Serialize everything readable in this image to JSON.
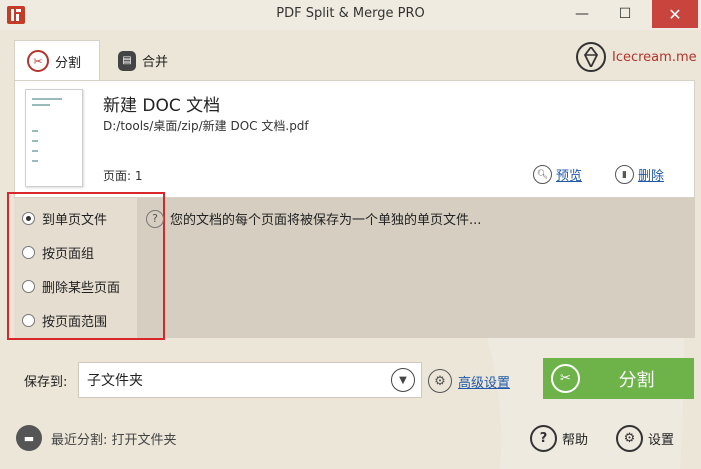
{
  "window": {
    "title": "PDF Split & Merge PRO",
    "min_glyph": "—",
    "max_glyph": "☐",
    "close_glyph": "✕"
  },
  "tabs": [
    {
      "label": "分割",
      "icon": "scissors-icon",
      "active": true
    },
    {
      "label": "合并",
      "icon": "merge-icon",
      "active": false
    }
  ],
  "brand": {
    "text": "Icecream.me",
    "icon": "icecream-logo-icon"
  },
  "file": {
    "name": "新建 DOC 文档",
    "path": "D:/tools/桌面/zip/新建 DOC 文档.pdf",
    "pages_label": "页面:",
    "pages_value": "1",
    "preview_label": "预览",
    "delete_label": "删除"
  },
  "options": {
    "items": [
      {
        "label": "到单页文件",
        "selected": true
      },
      {
        "label": "按页面组",
        "selected": false
      },
      {
        "label": "删除某些页面",
        "selected": false
      },
      {
        "label": "按页面范围",
        "selected": false
      }
    ],
    "help_text": "您的文档的每个页面将被保存为一个单独的单页文件..."
  },
  "save": {
    "label": "保存到:",
    "value": "子文件夹",
    "advanced_label": "高级设置",
    "split_button": "分割"
  },
  "footer": {
    "recent_label": "最近分割: 打开文件夹",
    "help_label": "帮助",
    "settings_label": "设置"
  },
  "colors": {
    "accent_red": "#b3342a",
    "split_green": "#6db34a",
    "link_blue": "#1f58a8",
    "highlight_red": "#d8262a"
  }
}
